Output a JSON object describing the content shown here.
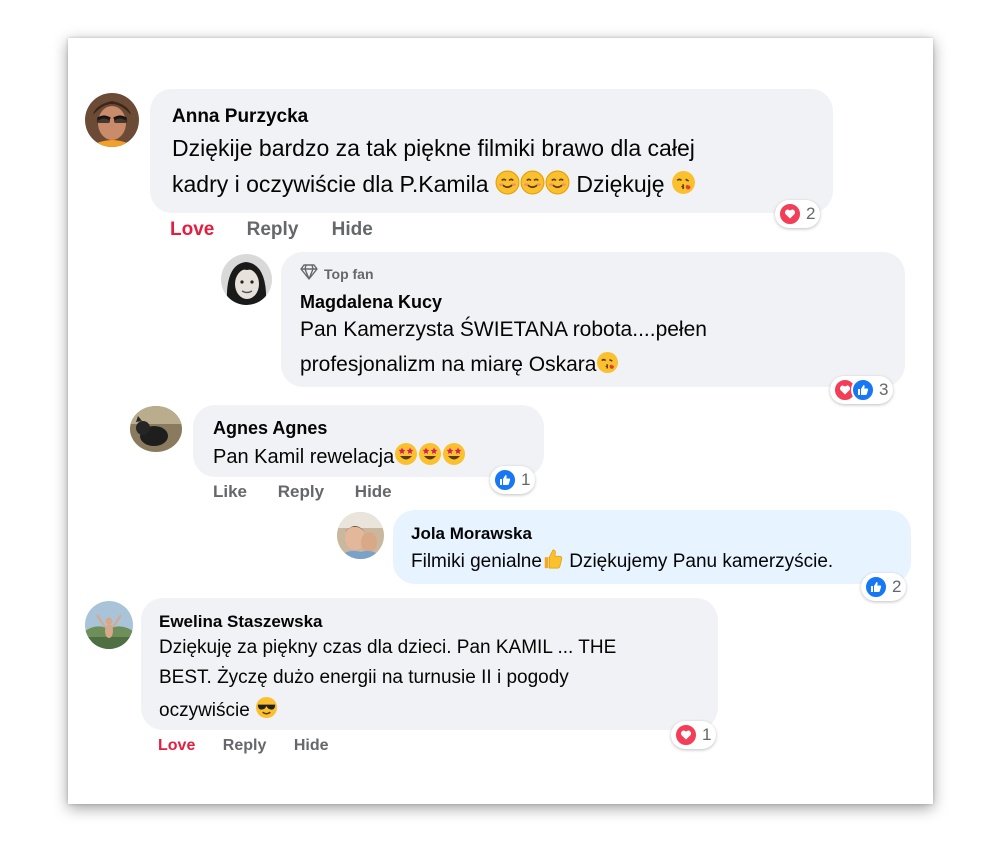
{
  "comments": [
    {
      "author": "Anna Purzycka",
      "lines": [
        "Dziękije bardzo za tak piękne filmiki brawo dla całej",
        "kadry i oczywiście dla P.Kamila",
        "Dziękuję"
      ],
      "reaction_count": "2",
      "actions": {
        "love": "Love",
        "reply": "Reply",
        "hide": "Hide"
      }
    },
    {
      "badge": "Top fan",
      "author": "Magdalena Kucy",
      "lines": [
        "Pan Kamerzysta ŚWIETANA robota....pełen",
        "profesjonalizm na miarę Oskara"
      ],
      "reaction_count": "3"
    },
    {
      "author": "Agnes Agnes",
      "lines": [
        "Pan Kamil rewelacja"
      ],
      "reaction_count": "1",
      "actions": {
        "like": "Like",
        "reply": "Reply",
        "hide": "Hide"
      }
    },
    {
      "author": "Jola Morawska",
      "lines": [
        "Filmiki genialne",
        "Dziękujemy Panu kamerzyście."
      ],
      "reaction_count": "2"
    },
    {
      "author": "Ewelina Staszewska",
      "lines": [
        "Dziękuję za piękny czas dla dzieci. Pan KAMIL ... THE",
        "BEST. Życzę dużo energii na turnusie II i pogody",
        "oczywiście"
      ],
      "reaction_count": "1",
      "actions": {
        "love": "Love",
        "reply": "Reply",
        "hide": "Hide"
      }
    }
  ],
  "colors": {
    "love": "#e41e3f",
    "bubble": "#f0f2f5",
    "highlight_bubble": "#e7f3ff",
    "like": "#1877f2",
    "heart": "#f33e58"
  },
  "icons": [
    "heart-reaction-icon",
    "like-reaction-icon",
    "diamond-icon",
    "smiling-face-emoji",
    "kissing-face-emoji",
    "star-struck-emoji",
    "thumbs-up-emoji",
    "sunglasses-emoji"
  ]
}
